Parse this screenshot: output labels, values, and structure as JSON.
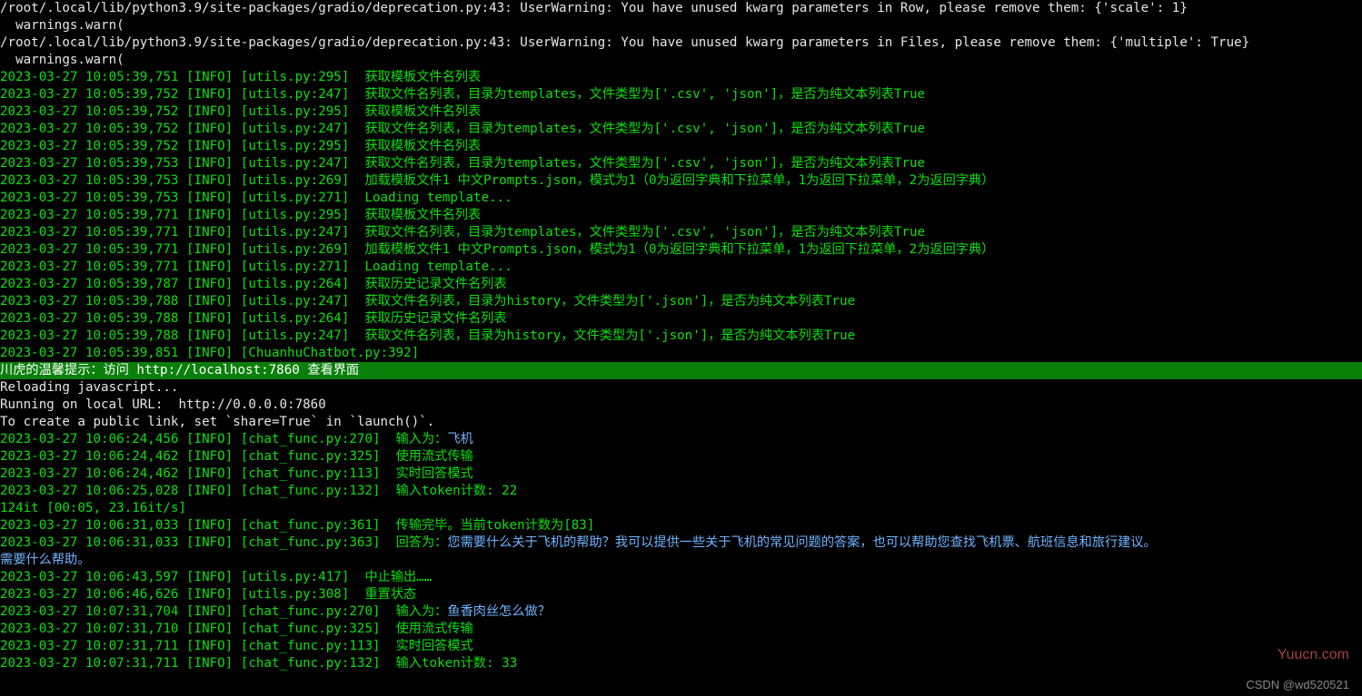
{
  "warnings": [
    "/root/.local/lib/python3.9/site-packages/gradio/deprecation.py:43: UserWarning: You have unused kwarg parameters in Row, please remove them: {'scale': 1}",
    "  warnings.warn(",
    "/root/.local/lib/python3.9/site-packages/gradio/deprecation.py:43: UserWarning: You have unused kwarg parameters in Files, please remove them: {'multiple': True}",
    "  warnings.warn("
  ],
  "logs1": [
    "2023-03-27 10:05:39,751 [INFO] [utils.py:295]  获取模板文件名列表",
    "2023-03-27 10:05:39,752 [INFO] [utils.py:247]  获取文件名列表，目录为templates，文件类型为['.csv', 'json']，是否为纯文本列表True",
    "2023-03-27 10:05:39,752 [INFO] [utils.py:295]  获取模板文件名列表",
    "2023-03-27 10:05:39,752 [INFO] [utils.py:247]  获取文件名列表，目录为templates，文件类型为['.csv', 'json']，是否为纯文本列表True",
    "2023-03-27 10:05:39,752 [INFO] [utils.py:295]  获取模板文件名列表",
    "2023-03-27 10:05:39,753 [INFO] [utils.py:247]  获取文件名列表，目录为templates，文件类型为['.csv', 'json']，是否为纯文本列表True",
    "2023-03-27 10:05:39,753 [INFO] [utils.py:269]  加载模板文件1 中文Prompts.json，模式为1（0为返回字典和下拉菜单，1为返回下拉菜单，2为返回字典）",
    "2023-03-27 10:05:39,753 [INFO] [utils.py:271]  Loading template...",
    "2023-03-27 10:05:39,771 [INFO] [utils.py:295]  获取模板文件名列表",
    "2023-03-27 10:05:39,771 [INFO] [utils.py:247]  获取文件名列表，目录为templates，文件类型为['.csv', 'json']，是否为纯文本列表True",
    "2023-03-27 10:05:39,771 [INFO] [utils.py:269]  加载模板文件1 中文Prompts.json，模式为1（0为返回字典和下拉菜单，1为返回下拉菜单，2为返回字典）",
    "2023-03-27 10:05:39,771 [INFO] [utils.py:271]  Loading template...",
    "2023-03-27 10:05:39,787 [INFO] [utils.py:264]  获取历史记录文件名列表",
    "2023-03-27 10:05:39,788 [INFO] [utils.py:247]  获取文件名列表，目录为history，文件类型为['.json']，是否为纯文本列表True",
    "2023-03-27 10:05:39,788 [INFO] [utils.py:264]  获取历史记录文件名列表",
    "2023-03-27 10:05:39,788 [INFO] [utils.py:247]  获取文件名列表，目录为history，文件类型为['.json']，是否为纯文本列表True",
    "2023-03-27 10:05:39,851 [INFO] [ChuanhuChatbot.py:392]"
  ],
  "banner": "川虎的温馨提示：访问 http://localhost:7860 查看界面",
  "post_banner": [
    "Reloading javascript...",
    "Running on local URL:  http://0.0.0.0:7860",
    "",
    "To create a public link, set `share=True` in `launch()`."
  ],
  "chat1": {
    "input_line_prefix": "2023-03-27 10:06:24,456 [INFO] [chat_func.py:270]  输入为：",
    "input_text": "飞机",
    "rest": [
      "2023-03-27 10:06:24,462 [INFO] [chat_func.py:325]  使用流式传输",
      "2023-03-27 10:06:24,462 [INFO] [chat_func.py:113]  实时回答模式",
      "2023-03-27 10:06:25,028 [INFO] [chat_func.py:132]  输入token计数: 22",
      "124it [00:05, 23.16it/s]",
      "2023-03-27 10:06:31,033 [INFO] [chat_func.py:361]  传输完毕。当前token计数为[83]"
    ],
    "answer_prefix": "2023-03-27 10:06:31,033 [INFO] [chat_func.py:363]  回答为：",
    "answer_text_line1": "您需要什么关于飞机的帮助？我可以提供一些关于飞机的常见问题的答案，也可以帮助您查找飞机票、航班信息和旅行建议。",
    "answer_text_line2": "需要什么帮助。"
  },
  "mid_logs": [
    "2023-03-27 10:06:43,597 [INFO] [utils.py:417]  中止输出……",
    "2023-03-27 10:06:46,626 [INFO] [utils.py:308]  重置状态"
  ],
  "chat2": {
    "input_line_prefix": "2023-03-27 10:07:31,704 [INFO] [chat_func.py:270]  输入为：",
    "input_text": "鱼香肉丝怎么做？",
    "rest": [
      "2023-03-27 10:07:31,710 [INFO] [chat_func.py:325]  使用流式传输",
      "2023-03-27 10:07:31,711 [INFO] [chat_func.py:113]  实时回答模式",
      "2023-03-27 10:07:31,711 [INFO] [chat_func.py:132]  输入token计数: 33"
    ]
  },
  "watermark_site": "Yuucn.com",
  "watermark_csdn": "CSDN @wd520521"
}
